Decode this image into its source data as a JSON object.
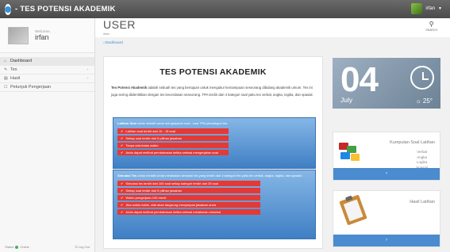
{
  "app": {
    "title": "- TES POTENSI AKADEMIK",
    "user": "irfan"
  },
  "sidebar": {
    "welcome": "Welcome,",
    "name": "irfan",
    "items": [
      {
        "label": "Dashboard",
        "icon": "home-icon",
        "glyph": "⌂"
      },
      {
        "label": "Tes",
        "icon": "edit-icon",
        "glyph": "✎"
      },
      {
        "label": "Hasil",
        "icon": "chart-icon",
        "glyph": "▤"
      },
      {
        "label": "Petunjuk Pengerjaan",
        "icon": "book-icon",
        "glyph": "☐"
      }
    ],
    "status": "Status",
    "status_value": "Online",
    "logout": "Log Out"
  },
  "header": {
    "title": "USER",
    "subtitle": "irfan",
    "search_label": "SEARCH"
  },
  "breadcrumb": "Dashboard",
  "main": {
    "title": "TES POTENSI AKADEMIK",
    "intro_bold": "Tes Potensi Akademik",
    "intro_text": " adalah sebuah tes yang bertujuan untuk mengukur kemampuan seseorang dibidang akademik umum. Tes ini juga sering diidentikkan dengan tes kecerdasan seseorang. TPA terdiri dari 4 kategori soal yaitu tes verbal, angka, logika, dan spasial.",
    "box1": {
      "bold": "Latihan Soal",
      "text": " untuk melatih anda mengerjakan soal - soal TPA persategori tes.",
      "rules": [
        "Latihan soal terdiri dari 10 - 15 soal",
        "Setiap soal terdiri dari 5 pilihan jawaban",
        "Tanpa ada batas waktu",
        "Anda dapat melihat pembahasan ketika selesai mengerjakan soal"
      ]
    },
    "box2": {
      "bold": "Simulasi Tes",
      "text": " untuk melatih anda melakukan simulasi tes yang terdiri dari 4 kategori tes yaitu tes verbal, angka, logika, dan spasial.",
      "rules": [
        "Simulasi tes terdiri dari 100 soal setiap kategori terdiri dari 25 soal",
        "Setiap soal terdiri dari 5 pilihan jawaban",
        "Waktu pengerjaan 100 menit",
        "Jika waktu habis, nilai akan langsung menyimpan jawaban anda",
        "Anda dapat melihat pembahasan ketika selesai melakukan simulasi"
      ]
    }
  },
  "date_widget": {
    "day": "04",
    "month": "July",
    "temperature": "25°"
  },
  "kumpulan": {
    "title": "Kumpulan Soal Latihan",
    "items": [
      "Verbal",
      "Angka",
      "Logika",
      "Spasial"
    ],
    "arrow": "›"
  },
  "hasil": {
    "title": "Hasil Latihan",
    "arrow": "›"
  }
}
